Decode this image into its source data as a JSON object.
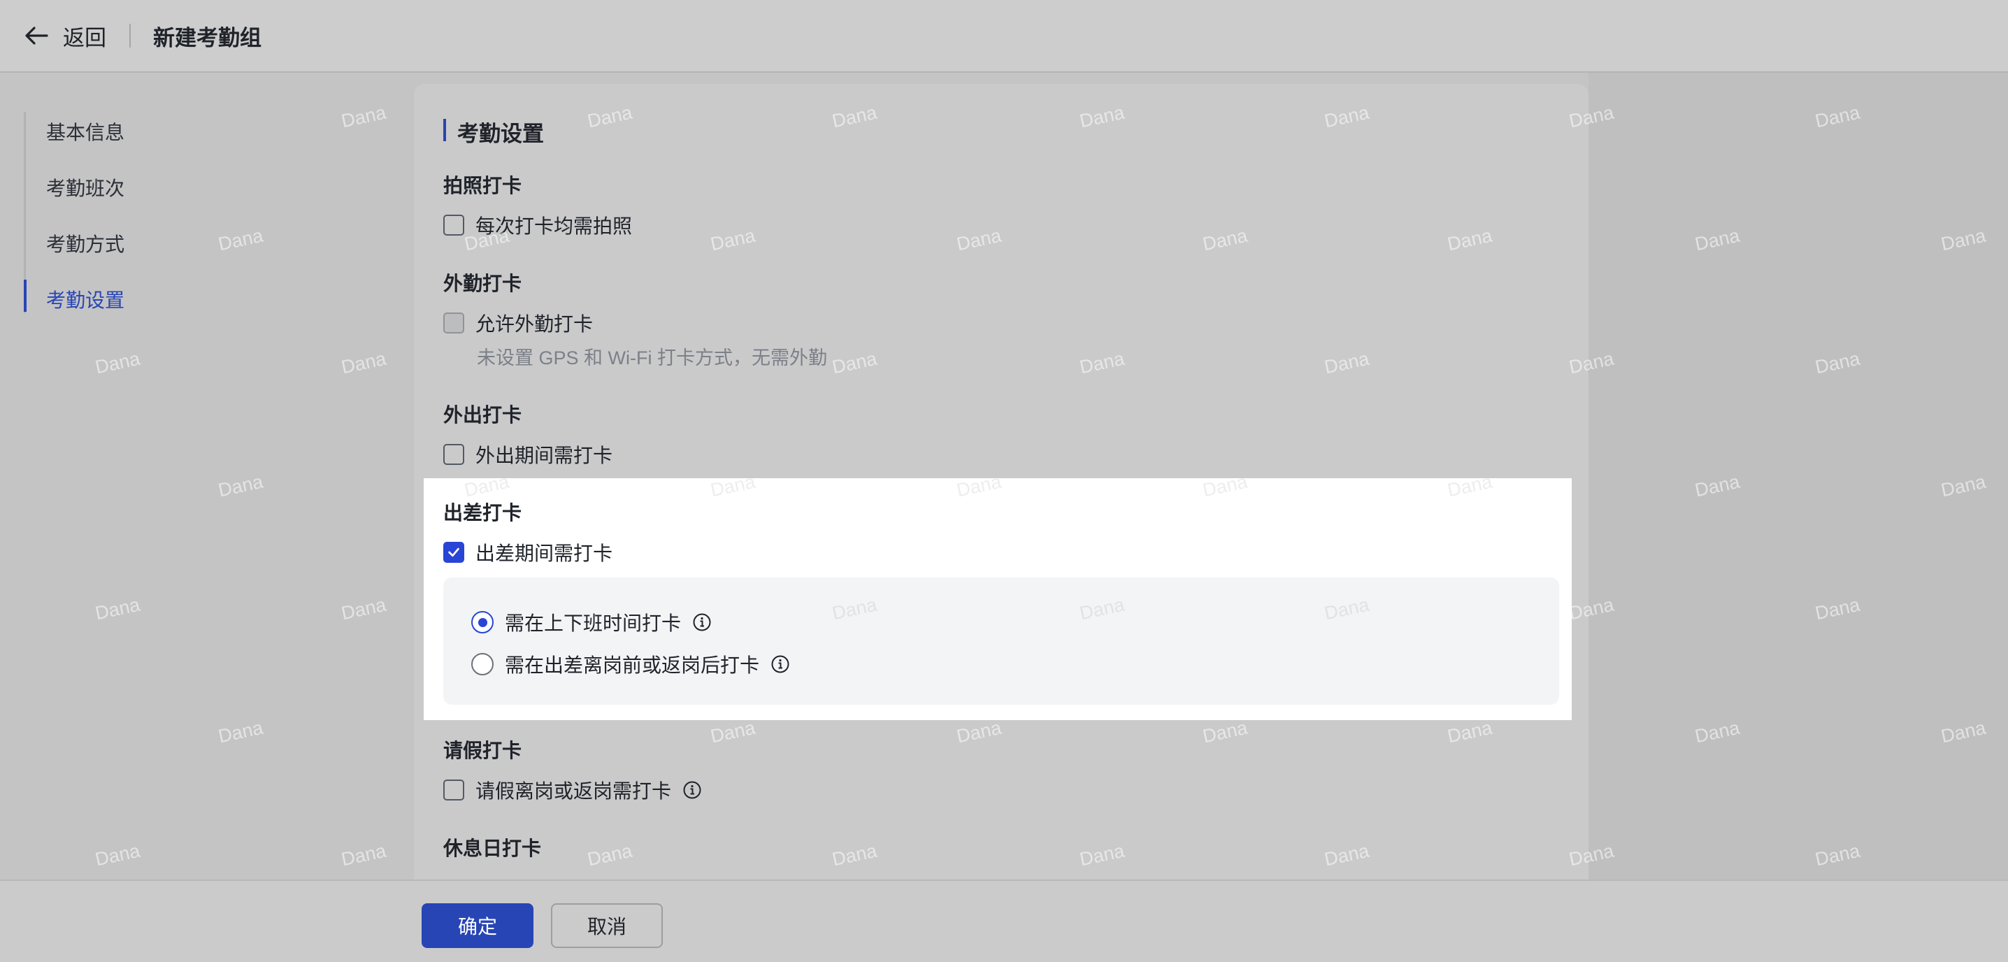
{
  "header": {
    "back_label": "返回",
    "title": "新建考勤组"
  },
  "nav": {
    "items": [
      {
        "label": "基本信息",
        "active": false
      },
      {
        "label": "考勤班次",
        "active": false
      },
      {
        "label": "考勤方式",
        "active": false
      },
      {
        "label": "考勤设置",
        "active": true
      }
    ]
  },
  "section": {
    "title": "考勤设置"
  },
  "groups": {
    "photo": {
      "title": "拍照打卡",
      "option": "每次打卡均需拍照",
      "checked": false
    },
    "field": {
      "title": "外勤打卡",
      "option": "允许外勤打卡",
      "checked": false,
      "disabled": true,
      "hint": "未设置 GPS 和 Wi-Fi 打卡方式，无需外勤"
    },
    "outing": {
      "title": "外出打卡",
      "option": "外出期间需打卡",
      "checked": false
    },
    "trip": {
      "title": "出差打卡",
      "option": "出差期间需打卡",
      "checked": true,
      "radios": [
        {
          "label": "需在上下班时间打卡",
          "selected": true
        },
        {
          "label": "需在出差离岗前或返岗后打卡",
          "selected": false
        }
      ]
    },
    "leave": {
      "title": "请假打卡",
      "option": "请假离岗或返岗需打卡",
      "checked": false
    },
    "rest": {
      "title": "休息日打卡"
    }
  },
  "footer": {
    "confirm_label": "确定",
    "cancel_label": "取消"
  },
  "watermark": {
    "text": "Dana"
  },
  "colors": {
    "accent": "#2845b5",
    "checkbox_on": "#2845d6",
    "overlay": "#c4c4c5"
  }
}
